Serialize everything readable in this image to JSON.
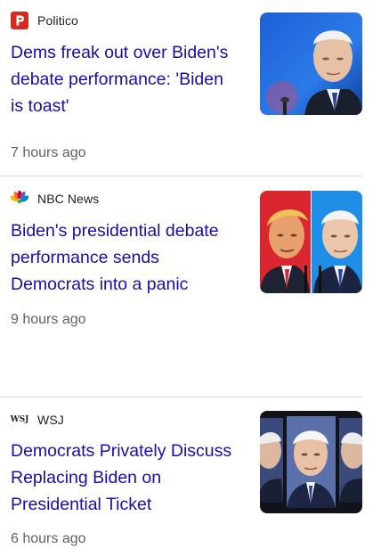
{
  "articles": [
    {
      "source": "Politico",
      "source_icon": "politico-logo-icon",
      "headline_lines": [
        "Dems freak out over Biden's",
        "debate performance: 'Biden",
        "is toast'"
      ],
      "time": "7 hours ago",
      "thumbnail": "biden-debate-photo"
    },
    {
      "source": "NBC News",
      "source_icon": "nbc-peacock-icon",
      "headline_lines": [
        "Biden's presidential debate",
        "performance sends",
        "Democrats into a panic"
      ],
      "time": "9 hours ago",
      "thumbnail": "trump-biden-split-photo"
    },
    {
      "source": "WSJ",
      "source_icon": "wsj-logo-icon",
      "source_logo_text": "WSJ",
      "headline_lines": [
        "Democrats Privately Discuss",
        "Replacing Biden on",
        "Presidential Ticket"
      ],
      "time": "6 hours ago",
      "thumbnail": "biden-triptych-photo"
    }
  ],
  "colors": {
    "headline": "#1a0dab",
    "source_text": "#202124",
    "timestamp": "#5f6368",
    "divider": "#dadce0",
    "politico_red": "#d52b1e"
  }
}
